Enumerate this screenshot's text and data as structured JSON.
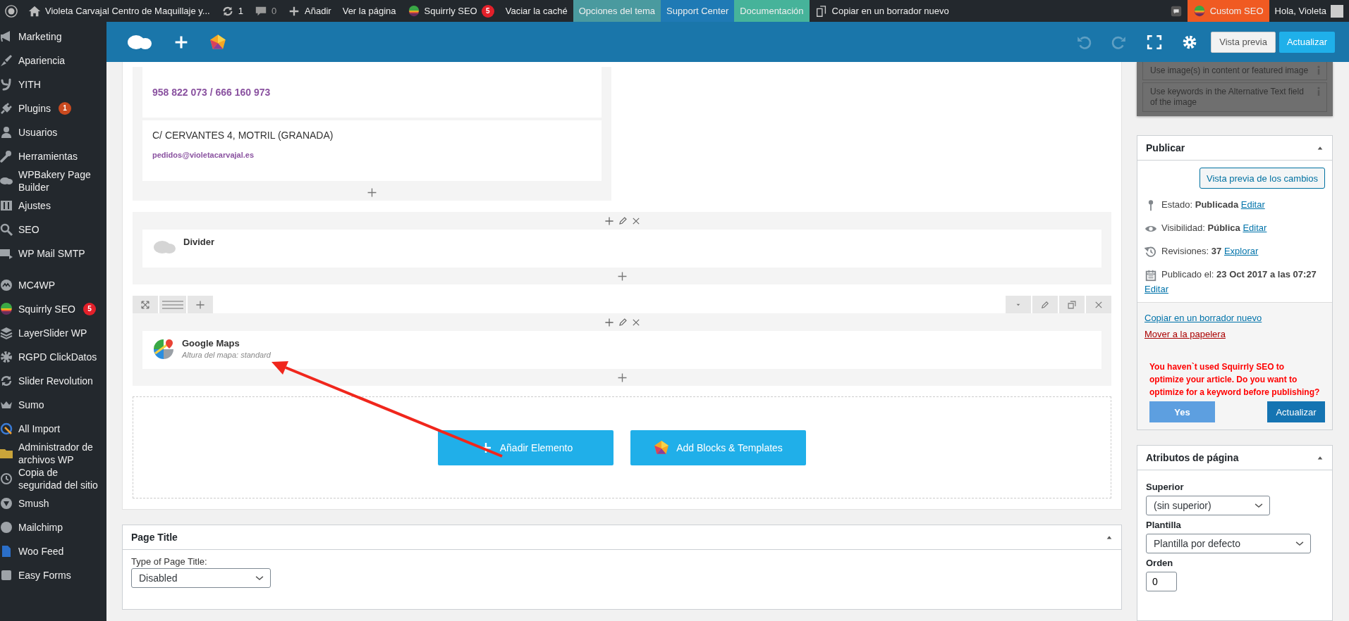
{
  "admin_bar": {
    "left": [
      {
        "kind": "logo"
      },
      {
        "kind": "home",
        "label": "Violeta Carvajal Centro de Maquillaje y..."
      },
      {
        "kind": "updates",
        "label": "1"
      },
      {
        "kind": "comments",
        "label": "0"
      },
      {
        "kind": "add",
        "label": "Añadir"
      },
      {
        "kind": "text",
        "label": "Ver la página"
      },
      {
        "kind": "squirrly",
        "label": "Squirrly SEO",
        "badge": "5"
      },
      {
        "kind": "text",
        "label": "Vaciar la caché"
      },
      {
        "kind": "text",
        "label": "Opciones del tema",
        "color": "#4a9a9f"
      },
      {
        "kind": "text",
        "label": "Support Center",
        "color": "#1f7ab5"
      },
      {
        "kind": "text",
        "label": "Documentación",
        "color": "#46b39a"
      },
      {
        "kind": "copy",
        "label": "Copiar en un borrador nuevo"
      }
    ],
    "right": [
      {
        "kind": "notice"
      },
      {
        "kind": "squirrly",
        "label": "Custom SEO",
        "color": "#f05a22"
      },
      {
        "kind": "account",
        "label": "Hola, Violeta"
      }
    ]
  },
  "sidebar": {
    "groups": [
      [
        {
          "label": "Marketing"
        },
        {
          "label": "Apariencia"
        },
        {
          "label": "YITH"
        },
        {
          "label": "Plugins",
          "badge": {
            "text": "1",
            "color": "#ca4a1f"
          }
        },
        {
          "label": "Usuarios"
        },
        {
          "label": "Herramientas"
        },
        {
          "label": "WPBakery Page Builder"
        },
        {
          "label": "Ajustes"
        },
        {
          "label": "SEO"
        },
        {
          "label": "WP Mail SMTP"
        }
      ],
      [
        {
          "label": "MC4WP"
        },
        {
          "label": "Squirrly SEO",
          "badge": {
            "text": "5",
            "color": "#e3202a"
          }
        },
        {
          "label": "LayerSlider WP"
        },
        {
          "label": "RGPD ClickDatos"
        },
        {
          "label": "Slider Revolution"
        },
        {
          "label": "Sumo"
        },
        {
          "label": "All Import"
        },
        {
          "label": "Administrador de archivos WP"
        },
        {
          "label": "Copia de seguridad del sitio"
        },
        {
          "label": "Smush"
        },
        {
          "label": "Mailchimp"
        },
        {
          "label": "Woo Feed"
        },
        {
          "label": "Easy Forms"
        }
      ]
    ]
  },
  "toolbar": {
    "tools": [
      {
        "kind": "undo",
        "disabled": true
      },
      {
        "kind": "redo",
        "disabled": true
      },
      {
        "kind": "fullscreen",
        "disabled": false
      },
      {
        "kind": "settings",
        "disabled": false
      }
    ],
    "buttons": [
      {
        "label": "Vista previa",
        "kind": "secondary"
      },
      {
        "label": "Actualizar",
        "kind": "primary"
      }
    ]
  },
  "editor": {
    "contact_row": {
      "phone": "958 822 073 / 666 160 973",
      "address": "C/ CERVANTES 4, MOTRIL (GRANADA)",
      "email": "pedidos@violetacarvajal.es"
    },
    "elements": [
      {
        "kind": "divider",
        "title": "Divider"
      },
      {
        "kind": "map",
        "title": "Google Maps",
        "subtitle": "Altura del mapa: standard"
      }
    ],
    "add_buttons": [
      {
        "kind": "add",
        "label": "Añadir Elemento"
      },
      {
        "kind": "templates",
        "label": "Add Blocks & Templates"
      }
    ]
  },
  "page_title": {
    "title": "Page Title",
    "field_label": "Type of Page Title:",
    "value": "Disabled"
  },
  "seo_checks": [
    "Use image(s) in content or featured image",
    "Use keywords in the Alternative Text field of the image"
  ],
  "publish": {
    "title": "Publicar",
    "preview_button": "Vista previa de los cambios",
    "rows": [
      {
        "label": "Estado:",
        "value": "Publicada",
        "link": "Editar"
      },
      {
        "label": "Visibilidad:",
        "value": "Pública",
        "link": "Editar"
      },
      {
        "label": "Revisiones:",
        "value": "37",
        "link": "Explorar"
      },
      {
        "label": "Publicado el:",
        "value": "23 Oct 2017 a las 07:27",
        "link": "Editar"
      }
    ],
    "links": [
      {
        "label": "Copiar en un borrador nuevo",
        "kind": "normal"
      },
      {
        "label": "Mover a la papelera",
        "kind": "danger"
      }
    ],
    "notice": "You haven`t used Squirrly SEO to optimize your article. Do you want to optimize for a keyword before publishing?",
    "buttons": [
      {
        "label": "Yes",
        "kind": "secondary"
      },
      {
        "label": "Actualizar",
        "kind": "primary"
      }
    ]
  },
  "attributes": {
    "title": "Atributos de página",
    "parent_label": "Superior",
    "parent_value": "(sin superior)",
    "template_label": "Plantilla",
    "template_value": "Plantilla por defecto",
    "order_label": "Orden",
    "order_value": "0"
  }
}
